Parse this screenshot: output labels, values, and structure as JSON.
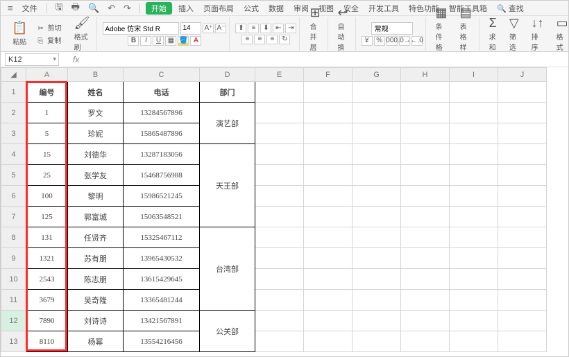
{
  "menu": {
    "file": "文件",
    "tabs": [
      "开始",
      "插入",
      "页面布局",
      "公式",
      "数据",
      "审阅",
      "视图",
      "安全",
      "开发工具",
      "特色功能",
      "智能工具箱"
    ],
    "search": "查找"
  },
  "ribbon": {
    "paste": "粘贴",
    "cut": "剪切",
    "copy": "复制",
    "format_painter": "格式刷",
    "font_name": "Adobe 仿宋 Std R",
    "font_size": "14",
    "merge_center": "合并居中",
    "auto_wrap": "自动换行",
    "style_normal": "常规",
    "cond_format": "条件格式",
    "table_style": "表格样式",
    "sum": "求和",
    "filter": "筛选",
    "sort": "排序",
    "format": "格式"
  },
  "namebox": "K12",
  "formula_bar": "",
  "fx": "fx",
  "columns": [
    "A",
    "B",
    "C",
    "D",
    "E",
    "F",
    "G",
    "H",
    "I",
    "J"
  ],
  "rows": [
    "1",
    "2",
    "3",
    "4",
    "5",
    "6",
    "7",
    "8",
    "9",
    "10",
    "11",
    "12",
    "13"
  ],
  "table": {
    "headers": {
      "id": "编号",
      "name": "姓名",
      "phone": "电话",
      "dept": "部门"
    },
    "rows": [
      {
        "id": "1",
        "name": "罗文",
        "phone": "13284567896"
      },
      {
        "id": "5",
        "name": "珍妮",
        "phone": "15865487896"
      },
      {
        "id": "15",
        "name": "刘德华",
        "phone": "13287183056"
      },
      {
        "id": "25",
        "name": "张学友",
        "phone": "15468756988"
      },
      {
        "id": "100",
        "name": "黎明",
        "phone": "15986521245"
      },
      {
        "id": "125",
        "name": "郭富城",
        "phone": "15063548521"
      },
      {
        "id": "131",
        "name": "任贤齐",
        "phone": "15325467112"
      },
      {
        "id": "1321",
        "name": "苏有朋",
        "phone": "13965430532"
      },
      {
        "id": "2543",
        "name": "陈志朋",
        "phone": "13615429645"
      },
      {
        "id": "3679",
        "name": "吴奇隆",
        "phone": "13365481244"
      },
      {
        "id": "7890",
        "name": "刘诗诗",
        "phone": "13421567891"
      },
      {
        "id": "8110",
        "name": "杨幂",
        "phone": "13554216456"
      }
    ],
    "dept_groups": [
      {
        "name": "演艺部",
        "span": 2
      },
      {
        "name": "天王部",
        "span": 4
      },
      {
        "name": "台湾部",
        "span": 4
      },
      {
        "name": "公关部",
        "span": 2
      }
    ]
  },
  "chart_data": {
    "type": "table",
    "title": "",
    "columns": [
      "编号",
      "姓名",
      "电话",
      "部门"
    ],
    "rows": [
      [
        1,
        "罗文",
        "13284567896",
        "演艺部"
      ],
      [
        5,
        "珍妮",
        "15865487896",
        "演艺部"
      ],
      [
        15,
        "刘德华",
        "13287183056",
        "天王部"
      ],
      [
        25,
        "张学友",
        "15468756988",
        "天王部"
      ],
      [
        100,
        "黎明",
        "15986521245",
        "天王部"
      ],
      [
        125,
        "郭富城",
        "15063548521",
        "天王部"
      ],
      [
        131,
        "任贤齐",
        "15325467112",
        "台湾部"
      ],
      [
        1321,
        "苏有朋",
        "13965430532",
        "台湾部"
      ],
      [
        2543,
        "陈志朋",
        "13615429645",
        "台湾部"
      ],
      [
        3679,
        "吴奇隆",
        "13365481244",
        "台湾部"
      ],
      [
        7890,
        "刘诗诗",
        "13421567891",
        "公关部"
      ],
      [
        8110,
        "杨幂",
        "13554216456",
        "公关部"
      ]
    ]
  }
}
